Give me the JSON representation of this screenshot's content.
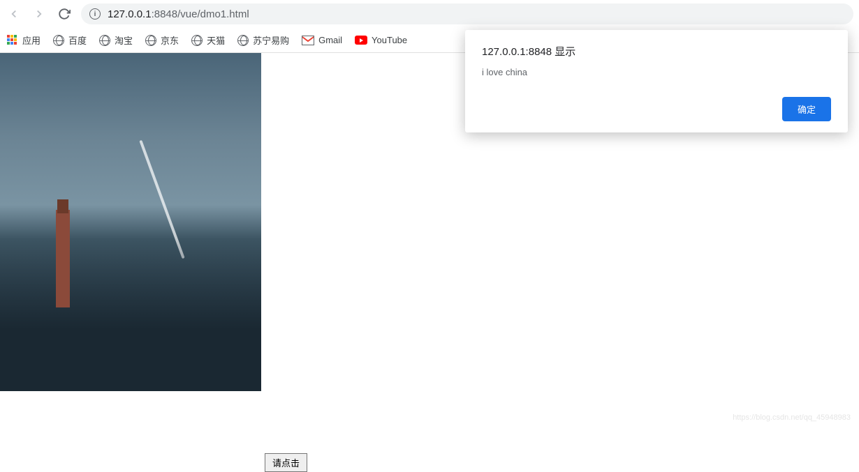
{
  "toolbar": {
    "url_prefix": "127.0.0.1",
    "url_port_path": ":8848/vue/dmo1.html"
  },
  "bookmarks": {
    "apps": "应用",
    "baidu": "百度",
    "taobao": "淘宝",
    "jd": "京东",
    "tmall": "天猫",
    "suning": "苏宁易购",
    "gmail": "Gmail",
    "youtube": "YouTube"
  },
  "page": {
    "click_button": "请点击"
  },
  "alert": {
    "title": "127.0.0.1:8848 显示",
    "message": "i love china",
    "ok": "确定"
  },
  "watermark": "https://blog.csdn.net/qq_45948983"
}
